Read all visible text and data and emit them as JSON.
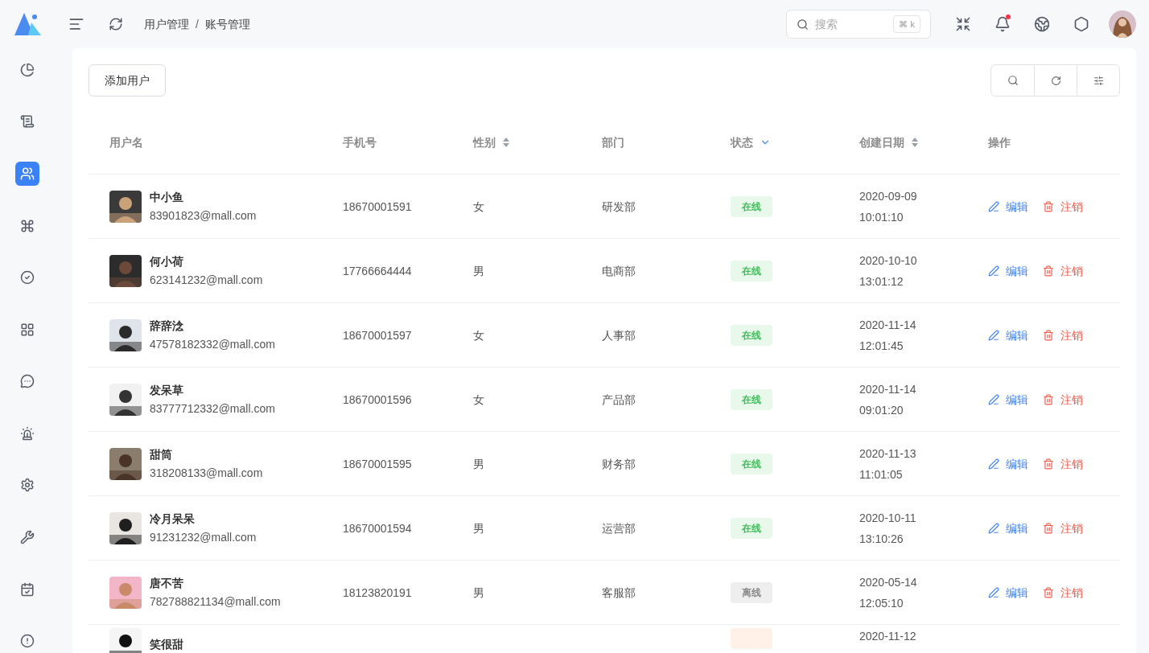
{
  "breadcrumb": {
    "items": [
      "用户管理",
      "账号管理"
    ],
    "separator": "/"
  },
  "search": {
    "placeholder": "搜索",
    "shortcut": "⌘ k"
  },
  "notifications": {
    "unread": true
  },
  "sidebar": {
    "items": [
      {
        "selected": false
      },
      {
        "selected": false
      },
      {
        "selected": true
      },
      {
        "selected": false
      },
      {
        "selected": false
      },
      {
        "selected": false
      },
      {
        "selected": false
      },
      {
        "selected": false
      },
      {
        "selected": false
      },
      {
        "selected": false
      },
      {
        "selected": false
      },
      {
        "selected": false
      }
    ]
  },
  "add_button": "添加用户",
  "table": {
    "columns": [
      {
        "label": "用户名"
      },
      {
        "label": "手机号"
      },
      {
        "label": "性别",
        "kind": "sort"
      },
      {
        "label": "部门"
      },
      {
        "label": "状态",
        "kind": "filter"
      },
      {
        "label": "创建日期",
        "kind": "sort"
      },
      {
        "label": "操作"
      }
    ],
    "rows": [
      {
        "name": "中小鱼",
        "email": "83901823@mall.com",
        "phone": "18670001591",
        "gender": "女",
        "dept": "研发部",
        "status": {
          "label": "在线",
          "kind": "online"
        },
        "date": "2020-09-09",
        "time": "10:01:10",
        "edit": "编辑",
        "cancel": "注销"
      },
      {
        "name": "何小荷",
        "email": "623141232@mall.com",
        "phone": "17766664444",
        "gender": "男",
        "dept": "电商部",
        "status": {
          "label": "在线",
          "kind": "online"
        },
        "date": "2020-10-10",
        "time": "13:01:12",
        "edit": "编辑",
        "cancel": "注销"
      },
      {
        "name": "辞辞淰",
        "email": "47578182332@mall.com",
        "phone": "18670001597",
        "gender": "女",
        "dept": "人事部",
        "status": {
          "label": "在线",
          "kind": "online"
        },
        "date": "2020-11-14",
        "time": "12:01:45",
        "edit": "编辑",
        "cancel": "注销"
      },
      {
        "name": "发呆草",
        "email": "83777712332@mall.com",
        "phone": "18670001596",
        "gender": "女",
        "dept": "产品部",
        "status": {
          "label": "在线",
          "kind": "online"
        },
        "date": "2020-11-14",
        "time": "09:01:20",
        "edit": "编辑",
        "cancel": "注销"
      },
      {
        "name": "甜筒",
        "email": "318208133@mall.com",
        "phone": "18670001595",
        "gender": "男",
        "dept": "财务部",
        "status": {
          "label": "在线",
          "kind": "online"
        },
        "date": "2020-11-13",
        "time": "11:01:05",
        "edit": "编辑",
        "cancel": "注销"
      },
      {
        "name": "冷月呆呆",
        "email": "91231232@mall.com",
        "phone": "18670001594",
        "gender": "男",
        "dept": "运营部",
        "status": {
          "label": "在线",
          "kind": "online"
        },
        "date": "2020-10-11",
        "time": "13:10:26",
        "edit": "编辑",
        "cancel": "注销"
      },
      {
        "name": "唐不苦",
        "email": "782788821134@mall.com",
        "phone": "18123820191",
        "gender": "男",
        "dept": "客服部",
        "status": {
          "label": "离线",
          "kind": "offline"
        },
        "date": "2020-05-14",
        "time": "12:05:10",
        "edit": "编辑",
        "cancel": "注销"
      },
      {
        "name": "笑很甜",
        "status": {
          "kind": "pending"
        },
        "date": "2020-11-12"
      }
    ]
  }
}
